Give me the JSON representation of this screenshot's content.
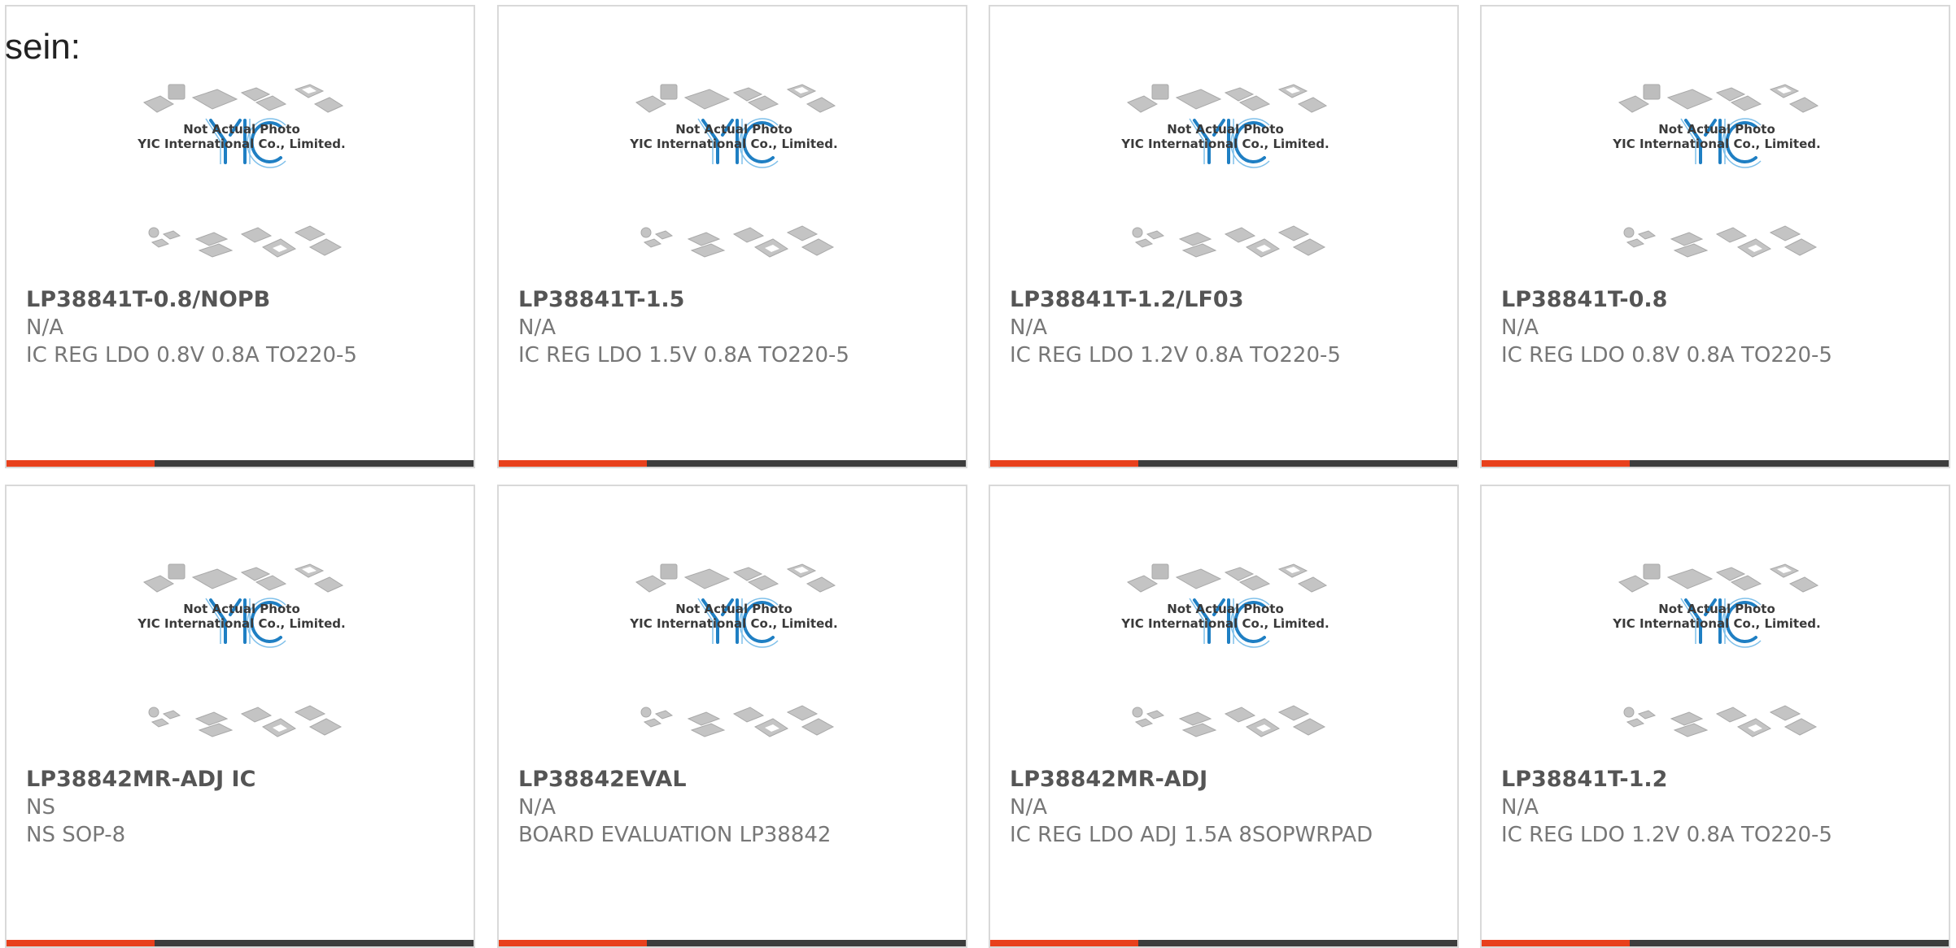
{
  "heading": "sein:",
  "placeholder": {
    "logo_text": "YIC",
    "caption_line1": "Not Actual Photo",
    "caption_line2": "YIC International Co., Limited."
  },
  "colors": {
    "accent": "#e8401c",
    "bar": "#3d3d3d",
    "logo": "#1f7fc3"
  },
  "products": [
    {
      "part": "LP38841T-0.8/NOPB",
      "manufacturer": "N/A",
      "description": "IC REG LDO 0.8V 0.8A TO220-5"
    },
    {
      "part": "LP38841T-1.5",
      "manufacturer": "N/A",
      "description": "IC REG LDO 1.5V 0.8A TO220-5"
    },
    {
      "part": "LP38841T-1.2/LF03",
      "manufacturer": "N/A",
      "description": "IC REG LDO 1.2V 0.8A TO220-5"
    },
    {
      "part": "LP38841T-0.8",
      "manufacturer": "N/A",
      "description": "IC REG LDO 0.8V 0.8A TO220-5"
    },
    {
      "part": "LP38842MR-ADJ IC",
      "manufacturer": "NS",
      "description": "NS SOP-8"
    },
    {
      "part": "LP38842EVAL",
      "manufacturer": "N/A",
      "description": "BOARD EVALUATION LP38842"
    },
    {
      "part": "LP38842MR-ADJ",
      "manufacturer": "N/A",
      "description": "IC REG LDO ADJ 1.5A 8SOPWRPAD"
    },
    {
      "part": "LP38841T-1.2",
      "manufacturer": "N/A",
      "description": "IC REG LDO 1.2V 0.8A TO220-5"
    }
  ]
}
